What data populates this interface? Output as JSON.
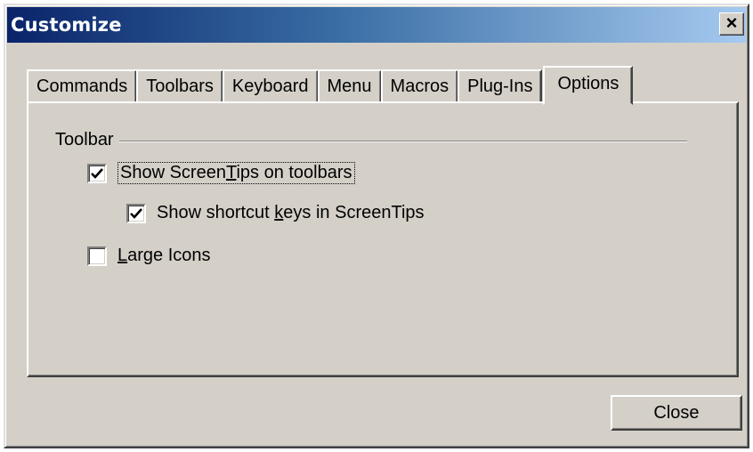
{
  "window": {
    "title": "Customize",
    "close_glyph": "×"
  },
  "tabs": [
    {
      "label": "Commands",
      "active": false
    },
    {
      "label": "Toolbars",
      "active": false
    },
    {
      "label": "Keyboard",
      "active": false
    },
    {
      "label": "Menu",
      "active": false
    },
    {
      "label": "Macros",
      "active": false
    },
    {
      "label": "Plug-Ins",
      "active": false
    },
    {
      "label": "Options",
      "active": true
    }
  ],
  "toolbar_group": {
    "label": "Toolbar",
    "show_screentips": {
      "before": "Show Screen",
      "mnemonic": "T",
      "after": "ips on toolbars",
      "checked": true
    },
    "show_shortcut_keys": {
      "before": "Show shortcut ",
      "mnemonic": "k",
      "after": "eys in ScreenTips",
      "checked": true
    },
    "large_icons": {
      "before": "",
      "mnemonic": "L",
      "after": "arge Icons",
      "checked": false
    }
  },
  "footer": {
    "close_label": "Close"
  },
  "icons": {
    "check": "checkmark-icon",
    "close": "close-icon"
  },
  "colors": {
    "face": "#d4d0c8",
    "title_start": "#0a246a",
    "title_end": "#a6caf0"
  }
}
